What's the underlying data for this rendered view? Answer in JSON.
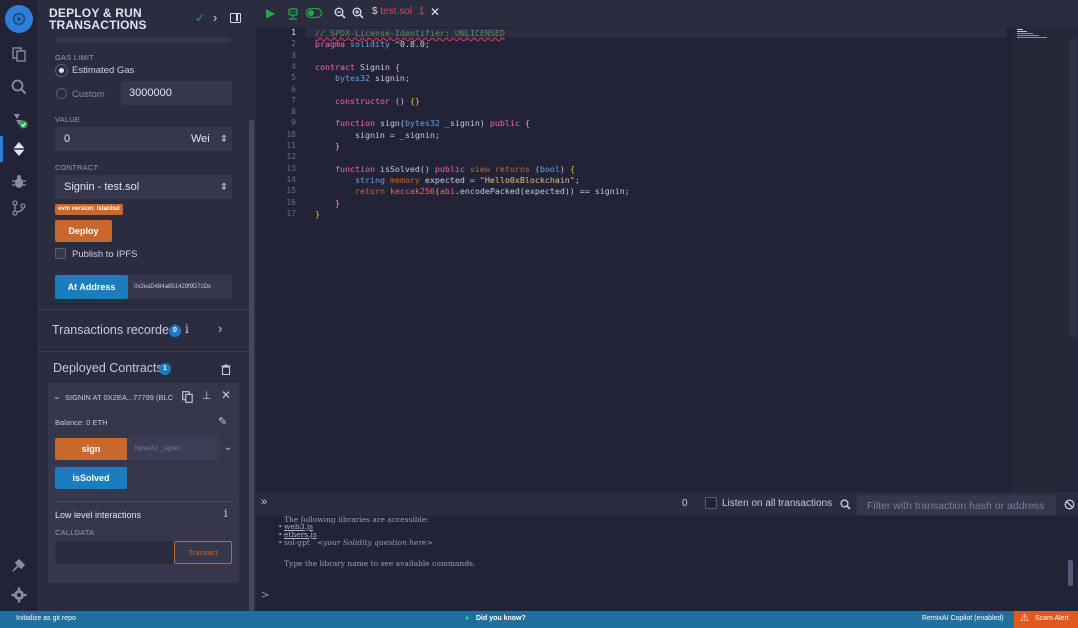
{
  "side_panel": {
    "title_line1": "DEPLOY & RUN",
    "title_line2": "TRANSACTIONS",
    "gas_limit_label": "GAS LIMIT",
    "estimated_gas_label": "Estimated Gas",
    "custom_label": "Custom",
    "custom_gas_value": "3000000",
    "value_label": "VALUE",
    "value_amount": "0",
    "value_unit": "Wei",
    "contract_label": "CONTRACT",
    "contract_selected": "Signin - test.sol",
    "evm_badge": "evm version: istanbul",
    "deploy_button": "Deploy",
    "publish_ipfs_label": "Publish to IPFS",
    "at_address_button": "At Address",
    "at_address_value": "0x2eaD484a851429f9D7cDx",
    "transactions_recorded_label": "Transactions recorded",
    "transactions_recorded_count": "0",
    "info_glyph": "i",
    "deployed_contracts_label": "Deployed Contracts",
    "deployed_contracts_count": "1",
    "deployed_contract_name": "SIGNIN AT 0X2EA...77799 (BLC",
    "balance_label": "Balance: 0 ETH",
    "sign_button": "sign",
    "sign_placeholder": "bytes32 _signin",
    "is_solved_button": "isSolved",
    "low_level_label": "Low level interactions",
    "calldata_label": "CALLDATA",
    "transact_button": "Transact"
  },
  "editor": {
    "tab_filename": "test.sol",
    "tab_modified": "1",
    "line_numbers": [
      "1",
      "2",
      "3",
      "4",
      "5",
      "6",
      "7",
      "8",
      "9",
      "10",
      "11",
      "12",
      "13",
      "14",
      "15",
      "16",
      "17"
    ],
    "code_lines": [
      "// SPDX-License-Identifier: UNLICENSED",
      "pragma solidity ^0.8.0;",
      "",
      "contract Signin {",
      "    bytes32 signin;",
      "",
      "    constructor () {}",
      "",
      "    function sign(bytes32 _signin) public {",
      "        signin = _signin;",
      "    }",
      "",
      "    function isSolved() public view returns (bool) {",
      "        string memory expected = \"Hello0xBlockchain\";",
      "        return keccak256(abi.encodePacked(expected)) == signin;",
      "    }",
      "}"
    ]
  },
  "terminal": {
    "pending_count": "0",
    "listen_label": "Listen on all transactions",
    "filter_placeholder": "Filter with transaction hash or address",
    "line_libs": "The following libraries are accessible:",
    "lib1": "web3.js",
    "lib2": "ethers.js",
    "lib3_prefix": "sol-gpt",
    "lib3_hint": "<your Solidity question here>",
    "hint_line": "Type the library name to see available commands.",
    "prompt": ">"
  },
  "status_bar": {
    "git_text": "Initialize as git repo",
    "did_you_know": "Did you know?",
    "copilot": "RemixAI Copilot (enabled)",
    "scam_alert": "Scam Alert"
  },
  "colors": {
    "accent_blue": "#1a7dbf",
    "accent_orange": "#c9682c",
    "error_red": "#ef3d56",
    "success_green": "#28a745"
  }
}
